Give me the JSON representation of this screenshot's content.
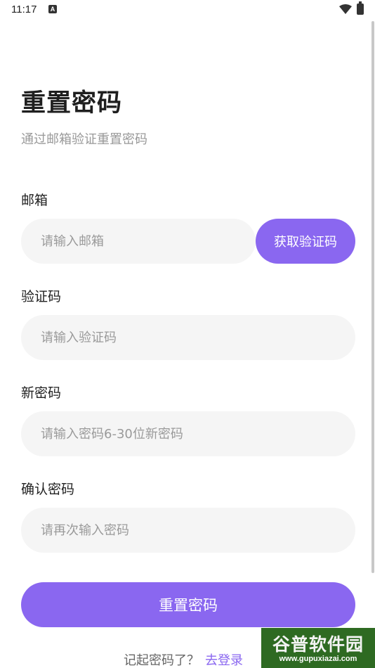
{
  "status_bar": {
    "time": "11:17",
    "notification_letter": "A"
  },
  "header": {
    "title": "重置密码",
    "subtitle": "通过邮箱验证重置密码"
  },
  "form": {
    "email": {
      "label": "邮箱",
      "placeholder": "请输入邮箱",
      "value": ""
    },
    "get_code_label": "获取验证码",
    "code": {
      "label": "验证码",
      "placeholder": "请输入验证码",
      "value": ""
    },
    "new_password": {
      "label": "新密码",
      "placeholder": "请输入密码6-30位新密码",
      "value": ""
    },
    "confirm_password": {
      "label": "确认密码",
      "placeholder": "请再次输入密码",
      "value": ""
    },
    "submit_label": "重置密码"
  },
  "footer": {
    "remember_text": "记起密码了？",
    "login_link": "去登录"
  },
  "watermark": {
    "brand": "谷普软件园",
    "url": "www.gupuxiazai.com"
  },
  "colors": {
    "accent": "#8a67f0",
    "input_bg": "#f5f5f5",
    "subtitle": "#999999"
  },
  "icons": {
    "wifi": "wifi-icon",
    "battery": "battery-icon"
  }
}
